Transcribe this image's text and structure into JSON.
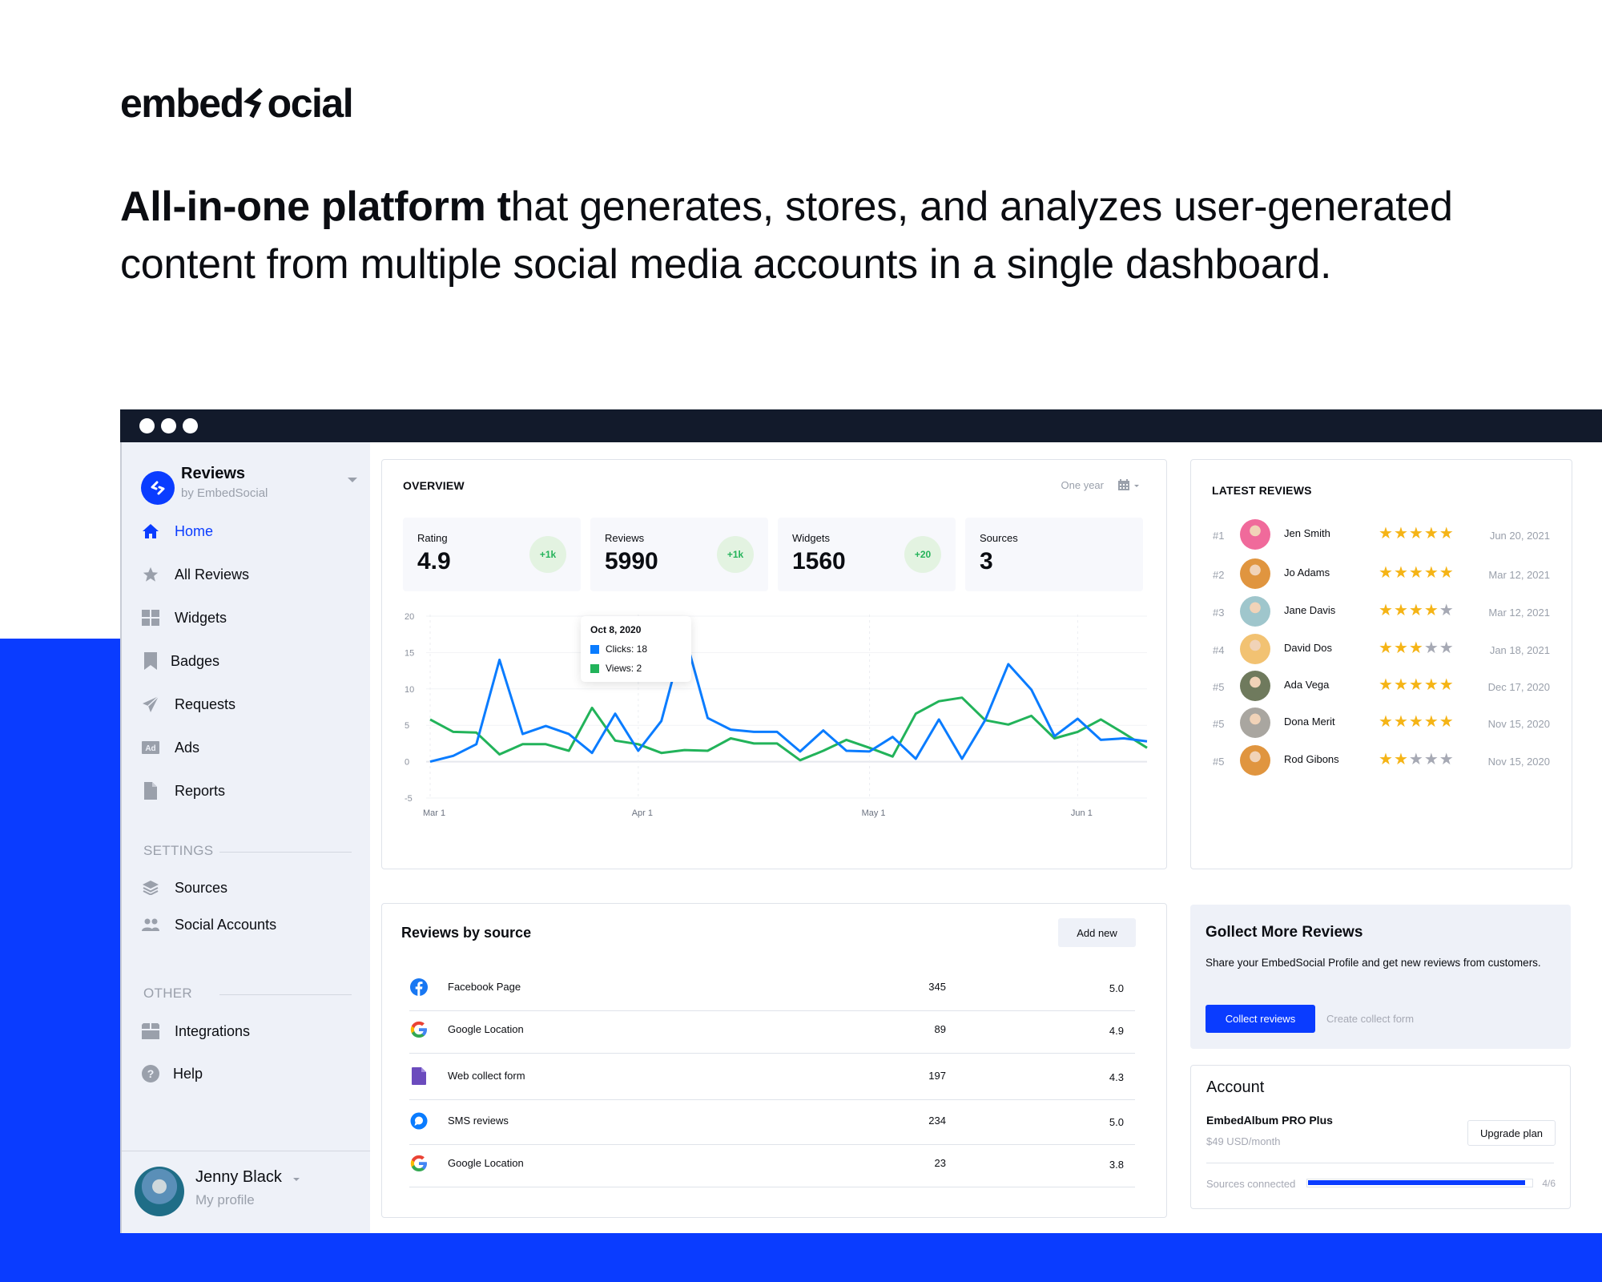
{
  "brand_logo": {
    "left": "embed",
    "mark": "<>",
    "right": "ocial"
  },
  "headline": {
    "bold": "All-in-one platform t",
    "rest": "hat generates, stores, and analyzes user-generated content from multiple social media accounts in a single dashboard."
  },
  "sidebar": {
    "app_title": "Reviews",
    "app_subtitle": "by EmbedSocial",
    "nav": [
      {
        "label": "Home",
        "icon": "home-icon",
        "active": true
      },
      {
        "label": "All Reviews",
        "icon": "star-icon"
      },
      {
        "label": "Widgets",
        "icon": "grid-icon"
      },
      {
        "label": "Badges",
        "icon": "bookmark-icon"
      },
      {
        "label": "Requests",
        "icon": "send-icon"
      },
      {
        "label": "Ads",
        "icon": "ad-icon"
      },
      {
        "label": "Reports",
        "icon": "file-icon"
      }
    ],
    "settings_label": "SETTINGS",
    "settings": [
      {
        "label": "Sources",
        "icon": "layers-icon"
      },
      {
        "label": "Social Accounts",
        "icon": "users-icon"
      }
    ],
    "other_label": "OTHER",
    "other": [
      {
        "label": "Integrations",
        "icon": "box-icon"
      },
      {
        "label": "Help",
        "icon": "help-icon"
      }
    ],
    "profile": {
      "name": "Jenny Black",
      "subtitle": "My profile"
    }
  },
  "overview": {
    "title": "OVERVIEW",
    "range": "One year",
    "stats": [
      {
        "label": "Rating",
        "value": "4.9",
        "badge": "+1k"
      },
      {
        "label": "Reviews",
        "value": "5990",
        "badge": "+1k"
      },
      {
        "label": "Widgets",
        "value": "1560",
        "badge": "+20"
      },
      {
        "label": "Sources",
        "value": "3",
        "badge": null
      }
    ],
    "tooltip": {
      "date": "Oct 8, 2020",
      "clicks": "Clicks: 18",
      "views": "Views: 2"
    }
  },
  "chart_data": {
    "type": "line",
    "title": "",
    "xlabel": "",
    "ylabel": "",
    "ylim": [
      -5,
      20
    ],
    "y_ticks": [
      "20",
      "15",
      "10",
      "5",
      "0",
      "-5"
    ],
    "x_tick_labels": [
      {
        "label": "Mar 1",
        "index": 0
      },
      {
        "label": "Apr 1",
        "index": 9
      },
      {
        "label": "May 1",
        "index": 19
      },
      {
        "label": "Jun 1",
        "index": 28
      }
    ],
    "grid": true,
    "highlight_index": 11,
    "series": [
      {
        "name": "Clicks",
        "color": "#0a7cff",
        "values": [
          0,
          0.8,
          2.4,
          14,
          3.8,
          4.9,
          3.8,
          1.2,
          6.6,
          1.5,
          5.6,
          17.5,
          6,
          4.4,
          4.1,
          4.1,
          1.4,
          4.3,
          1.5,
          1.4,
          3.4,
          0.4,
          5.8,
          0.4,
          5.7,
          13.4,
          9.9,
          3.5,
          5.9,
          3,
          3.2,
          2.8
        ]
      },
      {
        "name": "Views",
        "color": "#22b35a",
        "values": [
          5.8,
          4.1,
          4,
          1,
          2.4,
          2.4,
          1.5,
          7.4,
          2.9,
          2.4,
          1.2,
          1.6,
          1.5,
          3.2,
          2.5,
          2.5,
          0.2,
          1.5,
          3,
          1.9,
          0.7,
          6.6,
          8.3,
          8.8,
          5.7,
          5.1,
          6.3,
          3.2,
          4.1,
          5.8,
          3.9,
          1.9
        ]
      }
    ]
  },
  "latest_reviews": {
    "title": "LATEST REVIEWS",
    "items": [
      {
        "rank": "#1",
        "name": "Jen Smith",
        "stars": 5,
        "date": "Jun 20, 2021",
        "avatar_color": "#f06a9b"
      },
      {
        "rank": "#2",
        "name": "Jo Adams",
        "stars": 5,
        "date": "Mar 12, 2021",
        "avatar_color": "#e0953f"
      },
      {
        "rank": "#3",
        "name": "Jane Davis",
        "stars": 4,
        "date": "Mar 12, 2021",
        "avatar_color": "#9fc6cc"
      },
      {
        "rank": "#4",
        "name": "David Dos",
        "stars": 3,
        "date": "Jan 18, 2021",
        "avatar_color": "#f2c272"
      },
      {
        "rank": "#5",
        "name": "Ada Vega",
        "stars": 5,
        "date": "Dec 17, 2020",
        "avatar_color": "#6f7a5d"
      },
      {
        "rank": "#5",
        "name": "Dona Merit",
        "stars": 5,
        "date": "Nov 15, 2020",
        "avatar_color": "#a9a6a0"
      },
      {
        "rank": "#5",
        "name": "Rod Gibons",
        "stars": 2,
        "date": "Nov 15, 2020",
        "avatar_color": "#e0953f"
      }
    ]
  },
  "reviews_by_source": {
    "title": "Reviews by source",
    "add_new": "Add new",
    "rows": [
      {
        "icon": "facebook-icon",
        "name": "Facebook Page",
        "count": "345",
        "rating": "5.0"
      },
      {
        "icon": "google-icon",
        "name": "Google Location",
        "count": "89",
        "rating": "4.9"
      },
      {
        "icon": "form-icon",
        "name": "Web collect form",
        "count": "197",
        "rating": "4.3"
      },
      {
        "icon": "sms-icon",
        "name": "SMS reviews",
        "count": "234",
        "rating": "5.0"
      },
      {
        "icon": "google-icon",
        "name": "Google Location",
        "count": "23",
        "rating": "3.8"
      }
    ]
  },
  "collect": {
    "title": "Gollect More Reviews",
    "description": "Share your EmbedSocial Profile and get new reviews from customers.",
    "primary_button": "Collect reviews",
    "secondary_link": "Create collect form"
  },
  "account": {
    "title": "Account",
    "plan": "EmbedAlbum PRO Plus",
    "price": "$49 USD/month",
    "upgrade_button": "Upgrade plan",
    "progress_label": "Sources connected",
    "progress_value": "4/6",
    "progress_fraction": 0.98
  },
  "colors": {
    "brand": "#0a3cff",
    "clicks": "#0a7cff",
    "views": "#22b35a",
    "star": "#f5b416"
  }
}
